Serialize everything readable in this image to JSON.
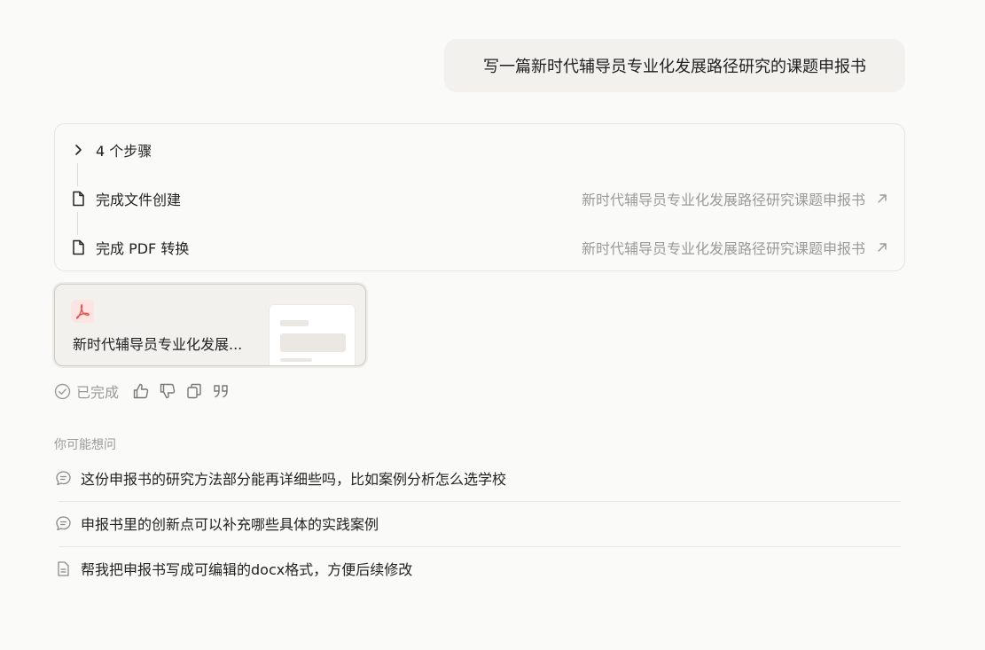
{
  "user_message": "写一篇新时代辅导员专业化发展路径研究的课题申报书",
  "steps": {
    "summary": "4 个步骤",
    "items": [
      {
        "label": "完成文件创建",
        "target": "新时代辅导员专业化发展路径研究课题申报书",
        "icon": "document-icon"
      },
      {
        "label": "完成 PDF 转换",
        "target": "新时代辅导员专业化发展路径研究课题申报书",
        "icon": "document-icon"
      }
    ]
  },
  "file_card": {
    "name": "新时代辅导员专业化发展...",
    "icon": "pdf-icon",
    "accent": "#e5534b"
  },
  "actions": {
    "status": "已完成",
    "buttons": [
      "thumbs-up-icon",
      "thumbs-down-icon",
      "copy-icon",
      "quote-icon"
    ]
  },
  "suggestions": {
    "title": "你可能想问",
    "items": [
      {
        "text": "这份申报书的研究方法部分能再详细些吗，比如案例分析怎么选学校",
        "icon": "chat-bubble-icon"
      },
      {
        "text": "申报书里的创新点可以补充哪些具体的实践案例",
        "icon": "chat-bubble-icon"
      },
      {
        "text": "帮我把申报书写成可编辑的docx格式，方便后续修改",
        "icon": "document-icon"
      }
    ]
  }
}
